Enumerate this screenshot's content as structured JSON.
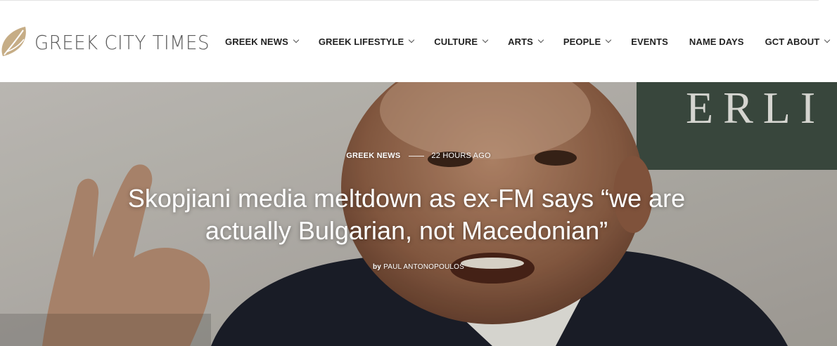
{
  "site": {
    "logo_text": "GREEK CITY TIMES",
    "brand_color": "#c6ad86"
  },
  "nav": {
    "items": [
      {
        "label": "GREEK NEWS",
        "has_dropdown": true
      },
      {
        "label": "GREEK LIFESTYLE",
        "has_dropdown": true
      },
      {
        "label": "CULTURE",
        "has_dropdown": true
      },
      {
        "label": "ARTS",
        "has_dropdown": true
      },
      {
        "label": "PEOPLE",
        "has_dropdown": true
      },
      {
        "label": "EVENTS",
        "has_dropdown": false
      },
      {
        "label": "NAME DAYS",
        "has_dropdown": false
      },
      {
        "label": "GCT ABOUT",
        "has_dropdown": true
      }
    ]
  },
  "article": {
    "category": "GREEK NEWS",
    "time": "22 HOURS AGO",
    "headline": "Skopjiani media meltdown as ex-FM says “we are actually Bulgarian, not Macedonian”",
    "byline_prefix": "by",
    "author": "PAUL ANTONOPOULOS",
    "background_sign_text": "ERLI"
  }
}
